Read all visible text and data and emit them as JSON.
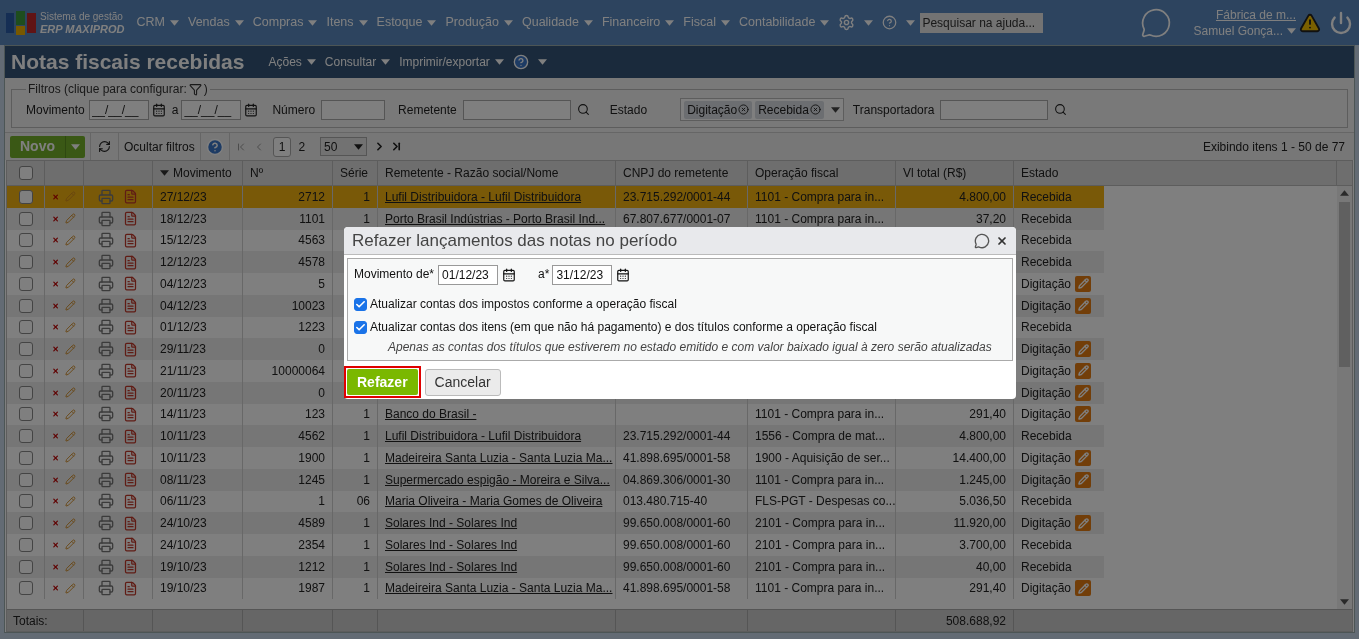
{
  "app": {
    "logo_line1": "Sistema de gestão",
    "logo_line2": "ERP MAXIPROD"
  },
  "menu": [
    "CRM",
    "Vendas",
    "Compras",
    "Itens",
    "Estoque",
    "Produção",
    "Qualidade",
    "Financeiro",
    "Fiscal",
    "Contabilidade"
  ],
  "help_search": {
    "placeholder": "Pesquisar na ajuda..."
  },
  "user": {
    "company": "Fábrica de m...",
    "name": "Samuel Gonça..."
  },
  "page": {
    "title": "Notas fiscais recebidas",
    "menus": [
      "Ações",
      "Consultar",
      "Imprimir/exportar"
    ]
  },
  "filters": {
    "legend": "Filtros (clique para configurar:",
    "legend_end": ")",
    "movimento": "Movimento",
    "date_from": {
      "placeholder": "__/__/__"
    },
    "date_sep": "a",
    "date_to": {
      "placeholder": "__/__/__"
    },
    "numero": "Número",
    "remetente": "Remetente",
    "estado": "Estado",
    "estado_tags": [
      "Digitação",
      "Recebida"
    ],
    "transportadora": "Transportadora"
  },
  "toolbar": {
    "new_button": "Novo",
    "hide_filters": "Ocultar filtros",
    "pages": [
      {
        "label": "1",
        "selected": true
      },
      {
        "label": "2",
        "selected": false
      }
    ],
    "page_size": "50",
    "status": "Exibindo itens 1 - 50 de 77"
  },
  "table": {
    "header_checkbox": {
      "checked": false
    },
    "columns": [
      {
        "label": "Movimento",
        "sorted": true
      },
      {
        "label": "Nº",
        "sorted": false
      },
      {
        "label": "Série",
        "sorted": false
      },
      {
        "label": "Remetente - Razão social/Nome",
        "sorted": false
      },
      {
        "label": "CNPJ do remetente",
        "sorted": false
      },
      {
        "label": "Operação fiscal",
        "sorted": false
      },
      {
        "label": "Vl total (R$)",
        "sorted": false
      },
      {
        "label": "Estado",
        "sorted": false
      }
    ],
    "rows": [
      {
        "selected": true,
        "checked": false,
        "movimento": "27/12/23",
        "numero": "2712",
        "serie": "1",
        "remetente": "Lufil Distribuidora - Lufil Distribuidora",
        "cnpj": "23.715.292/0001-44",
        "operacao": "1101 - Compra para in...",
        "total": "4.800,00",
        "estado": "Recebida",
        "edit_icon": false
      },
      {
        "selected": false,
        "checked": false,
        "movimento": "18/12/23",
        "numero": "1101",
        "serie": "1",
        "remetente": "Porto Brasil Indústrias - Porto Brasil Ind...",
        "cnpj": "67.807.677/0001-07",
        "operacao": "1101 - Compra para in...",
        "total": "37,20",
        "estado": "Recebida",
        "edit_icon": false
      },
      {
        "selected": false,
        "checked": false,
        "movimento": "15/12/23",
        "numero": "4563",
        "estado": "Recebida",
        "edit_icon": false
      },
      {
        "selected": false,
        "checked": false,
        "movimento": "12/12/23",
        "numero": "4578",
        "estado": "Recebida",
        "edit_icon": false
      },
      {
        "selected": false,
        "checked": false,
        "movimento": "04/12/23",
        "numero": "5",
        "estado": "Digitação",
        "edit_icon": true
      },
      {
        "selected": false,
        "checked": false,
        "movimento": "04/12/23",
        "numero": "10023",
        "estado": "Digitação",
        "edit_icon": true
      },
      {
        "selected": false,
        "checked": false,
        "movimento": "01/12/23",
        "numero": "1223",
        "estado": "Recebida",
        "edit_icon": false
      },
      {
        "selected": false,
        "checked": false,
        "movimento": "29/11/23",
        "numero": "0",
        "estado": "Digitação",
        "edit_icon": true
      },
      {
        "selected": false,
        "checked": false,
        "movimento": "21/11/23",
        "numero": "10000064",
        "estado": "Digitação",
        "edit_icon": true
      },
      {
        "selected": false,
        "checked": false,
        "movimento": "20/11/23",
        "numero": "0",
        "estado": "Digitação",
        "edit_icon": true
      },
      {
        "selected": false,
        "checked": false,
        "movimento": "14/11/23",
        "numero": "123",
        "serie": "1",
        "remetente": "Banco do Brasil -",
        "operacao": "1101 - Compra para in...",
        "total": "291,40",
        "estado": "Digitação",
        "edit_icon": true
      },
      {
        "selected": false,
        "checked": false,
        "movimento": "10/11/23",
        "numero": "4562",
        "serie": "1",
        "remetente": "Lufil Distribuidora - Lufil Distribuidora",
        "cnpj": "23.715.292/0001-44",
        "operacao": "1556 - Compra de mat...",
        "total": "4.800,00",
        "estado": "Recebida",
        "edit_icon": false
      },
      {
        "selected": false,
        "checked": false,
        "movimento": "10/11/23",
        "numero": "1900",
        "serie": "1",
        "remetente": "Madeireira Santa Luzia - Santa Luzia Ma...",
        "cnpj": "41.898.695/0001-58",
        "operacao": "1900 - Aquisição de ser...",
        "total": "14.400,00",
        "estado": "Digitação",
        "edit_icon": true
      },
      {
        "selected": false,
        "checked": false,
        "movimento": "08/11/23",
        "numero": "1245",
        "serie": "1",
        "remetente": "Supermercado espigão - Moreira e Silva...",
        "cnpj": "04.869.306/0001-30",
        "operacao": "1101 - Compra para in...",
        "total": "1.245,00",
        "estado": "Digitação",
        "edit_icon": true
      },
      {
        "selected": false,
        "checked": false,
        "movimento": "06/11/23",
        "numero": "1",
        "serie": "06",
        "remetente": "Maria Oliveira - Maria Gomes de Oliveira",
        "cnpj": "013.480.715-40",
        "operacao": "FLS-PGT - Despesas co...",
        "total": "5.036,50",
        "estado": "Recebida",
        "edit_icon": false
      },
      {
        "selected": false,
        "checked": false,
        "movimento": "24/10/23",
        "numero": "4589",
        "serie": "1",
        "remetente": "Solares Ind - Solares Ind",
        "cnpj": "99.650.008/0001-60",
        "operacao": "2101 - Compra para in...",
        "total": "11.920,00",
        "estado": "Digitação",
        "edit_icon": true
      },
      {
        "selected": false,
        "checked": false,
        "movimento": "24/10/23",
        "numero": "2354",
        "serie": "1",
        "remetente": "Solares Ind - Solares Ind",
        "cnpj": "99.650.008/0001-60",
        "operacao": "2101 - Compra para in...",
        "total": "3.700,00",
        "estado": "Recebida",
        "edit_icon": false
      },
      {
        "selected": false,
        "checked": false,
        "movimento": "19/10/23",
        "numero": "1212",
        "serie": "1",
        "remetente": "Solares Ind - Solares Ind",
        "cnpj": "99.650.008/0001-60",
        "operacao": "2101 - Compra para in...",
        "total": "40,00",
        "estado": "Recebida",
        "edit_icon": false
      },
      {
        "selected": false,
        "checked": false,
        "movimento": "19/10/23",
        "numero": "1987",
        "serie": "1",
        "remetente": "Madeireira Santa Luzia - Santa Luzia Ma...",
        "cnpj": "41.898.695/0001-58",
        "operacao": "1101 - Compra para in...",
        "total": "291,40",
        "estado": "Digitação",
        "edit_icon": true
      }
    ],
    "totals": {
      "label": "Totais:",
      "total": "508.688,92"
    }
  },
  "dialog": {
    "title": "Refazer lançamentos das notas no período",
    "from_label": "Movimento de*",
    "from_value": "01/12/23",
    "to_label": "a*",
    "to_value": "31/12/23",
    "options": [
      {
        "label": "Atualizar contas dos impostos conforme a operação fiscal",
        "checked": true
      },
      {
        "label": "Atualizar contas dos itens (em que não há pagamento) e dos títulos conforme a operação fiscal",
        "checked": true
      }
    ],
    "note": "Apenas as contas dos títulos que estiverem no estado emitido e com valor baixado igual à zero serão atualizadas",
    "primary_button": "Refazer",
    "secondary_button": "Cancelar"
  }
}
